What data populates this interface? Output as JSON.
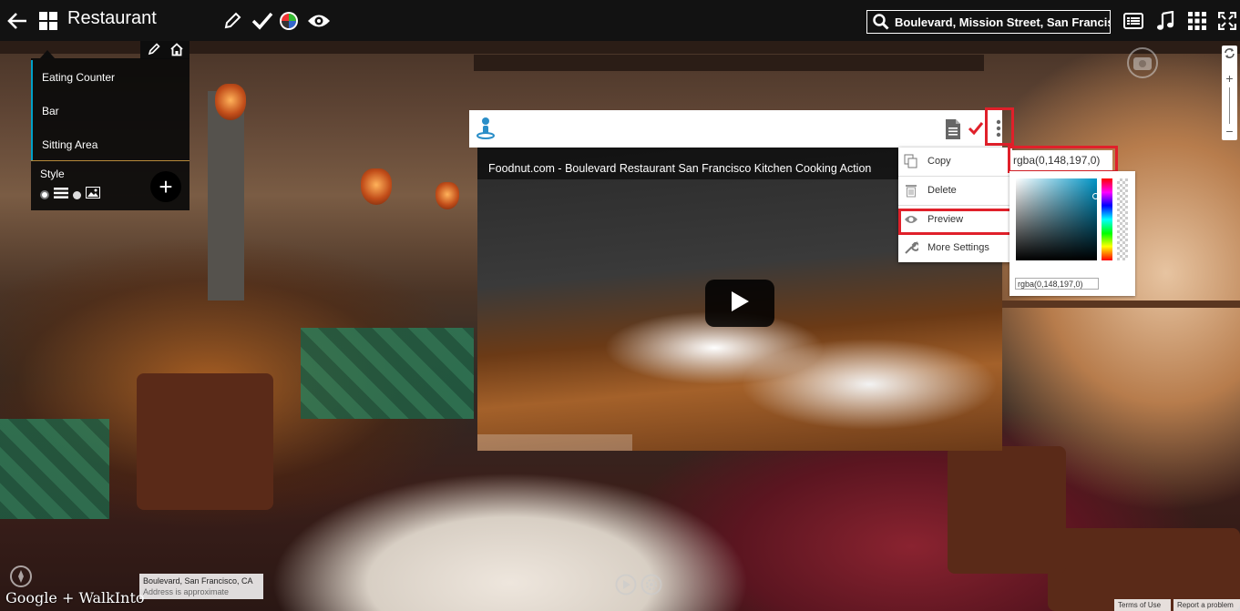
{
  "topbar": {
    "back_icon": "arrow-left-icon",
    "grid_icon": "grid-icon",
    "title": "Restaurant",
    "tools": [
      "pencil-icon",
      "check-icon",
      "color-wheel-icon",
      "eye-icon"
    ],
    "search": {
      "icon": "search-icon",
      "value": "Boulevard, Mission Street, San Francisc"
    },
    "right_icons": [
      "list-icon",
      "music-icon",
      "apps-grid-icon",
      "fullscreen-icon"
    ]
  },
  "side_panel": {
    "head_icons": [
      "pencil-icon",
      "home-edit-icon"
    ],
    "items": [
      {
        "label": "Eating Counter"
      },
      {
        "label": "Bar"
      },
      {
        "label": "Sitting Area"
      }
    ],
    "style_label": "Style",
    "style_icons": [
      "dot-icon",
      "lines-icon",
      "dot-icon",
      "image-icon"
    ],
    "add_label": "+"
  },
  "card": {
    "person_icon": "person-pin-icon",
    "doc_icon": "document-icon",
    "check_icon": "check-icon",
    "more_icon": "more-vert-icon",
    "video_title": "Foodnut.com - Boulevard Restaurant San Francisco Kitchen Cooking Action",
    "play_icon": "play-icon"
  },
  "context_menu": {
    "items": [
      {
        "label": "Copy",
        "icon": "copy-icon"
      },
      {
        "label": "Delete",
        "icon": "trash-icon"
      },
      {
        "label": "Preview",
        "icon": "eye-icon"
      },
      {
        "label": "More Settings",
        "icon": "wrench-icon"
      }
    ]
  },
  "color_picker": {
    "input_value": "rgba(0,148,197,0)",
    "text_value": "rgba(0,148,197,0)",
    "base_color": "#0094c5"
  },
  "map_controls": {
    "rotate_icon": "rotate-icon",
    "zoom_in": "+",
    "zoom_out": "−",
    "camera_icon": "camera-icon"
  },
  "footer": {
    "brand": "Google + WalkInto",
    "location_line1": "Boulevard, San Francisco, CA",
    "location_line2": "Address is approximate",
    "terms": "Terms of Use",
    "report": "Report a problem",
    "play_icon": "play-circle-icon",
    "settings_icon": "settings-icon",
    "compass_icon": "compass-icon"
  },
  "colors": {
    "accent_red": "#e0202a",
    "accent_blue": "#00a0c8",
    "topbar": "#121212"
  }
}
